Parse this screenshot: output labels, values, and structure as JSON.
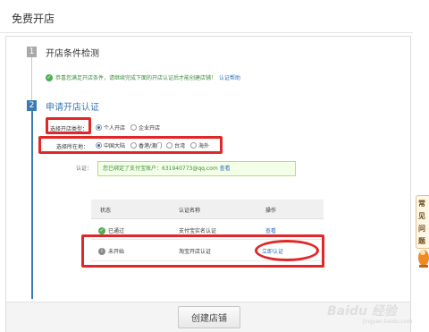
{
  "page": {
    "title": "免费开店"
  },
  "step1": {
    "number": "1",
    "title": "开店条件检测",
    "message": "恭喜您满足开店条件，请继续完成下面的开店认证后才能创建店铺！",
    "help_link": "认证帮助"
  },
  "step2": {
    "number": "2",
    "title": "申请开店认证",
    "shop_type": {
      "label": "选择开店类型：",
      "options": [
        "个人开店",
        "企业开店"
      ],
      "selected": "个人开店"
    },
    "region": {
      "label": "选择所在地：",
      "options": [
        "中国大陆",
        "香港/澳门",
        "台湾",
        "海外"
      ],
      "selected": "中国大陆"
    },
    "cert": {
      "label": "认证：",
      "message": "您已绑定了支付宝账户：631940773@qq.com",
      "link": "查看"
    },
    "table": {
      "headers": [
        "状态",
        "认证名称",
        "操作"
      ],
      "rows": [
        {
          "status": "已通过",
          "name": "支付宝实名认证",
          "action": "查看",
          "state": "passed"
        },
        {
          "status": "未开始",
          "name": "淘宝开店认证",
          "action": "立即认证",
          "state": "pending"
        }
      ]
    }
  },
  "footer": {
    "create_button": "创建店铺"
  },
  "faq": {
    "chars": [
      "常",
      "见",
      "问",
      "题"
    ]
  },
  "watermark": {
    "text": "Baidu 经验",
    "sub": "jingyan.baidu.com"
  },
  "colors": {
    "highlight": "#e02828",
    "accent": "#3a7ab5",
    "success": "#4caf50",
    "link": "#2f6fb8"
  }
}
